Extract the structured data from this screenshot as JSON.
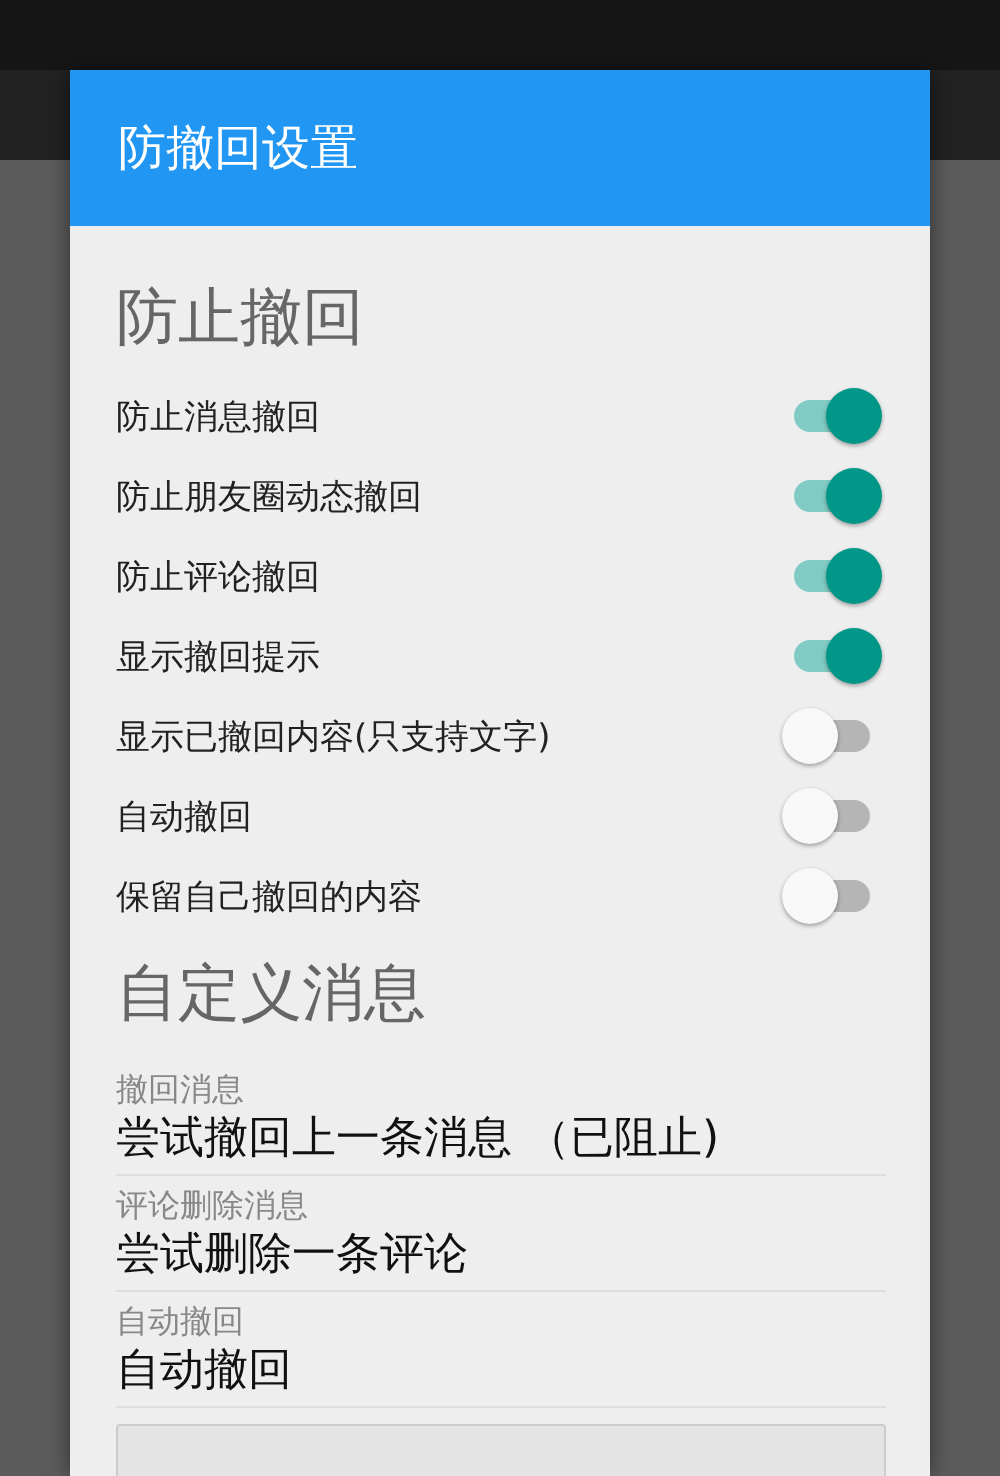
{
  "dialog": {
    "title": "防撤回设置",
    "sections": [
      {
        "heading": "防止撤回",
        "items": [
          {
            "kind": "switch",
            "label": "防止消息撤回",
            "on": true
          },
          {
            "kind": "switch",
            "label": "防止朋友圈动态撤回",
            "on": true
          },
          {
            "kind": "switch",
            "label": "防止评论撤回",
            "on": true
          },
          {
            "kind": "switch",
            "label": "显示撤回提示",
            "on": true
          },
          {
            "kind": "switch",
            "label": "显示已撤回内容(只支持文字)",
            "on": false
          },
          {
            "kind": "switch",
            "label": "自动撤回",
            "on": false
          },
          {
            "kind": "switch",
            "label": "保留自己撤回的内容",
            "on": false
          }
        ]
      },
      {
        "heading": "自定义消息",
        "items": [
          {
            "kind": "text",
            "label": "撤回消息",
            "value": "尝试撤回上一条消息 （已阻止)"
          },
          {
            "kind": "text",
            "label": "评论删除消息",
            "value": "尝试删除一条评论"
          },
          {
            "kind": "text",
            "label": "自动撤回",
            "value": "自动撤回"
          }
        ]
      }
    ]
  }
}
